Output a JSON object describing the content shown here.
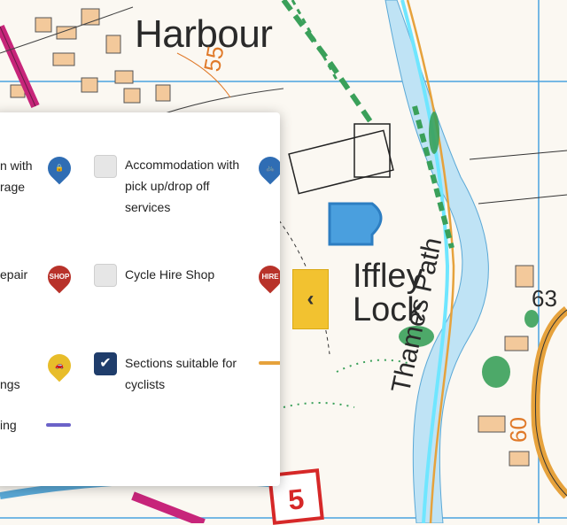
{
  "map": {
    "place_labels": {
      "harbour": "Harbour",
      "iffley_lock": "Iffley Lock",
      "thames_path": "Thames Path",
      "contour_55": "55",
      "contour_60": "60",
      "house_63": "63",
      "road_number": "5"
    },
    "colors": {
      "river": "#bfe3f5",
      "footpath_green": "#3aa05a",
      "cycle_route": "#e6a23c",
      "road_magenta": "#c7257a",
      "building": "#f3c99b"
    }
  },
  "legend": {
    "items": [
      {
        "label": "n with",
        "label2": "rage",
        "icon": "bike-lock-pin-icon",
        "color": "#2f6db4",
        "checked": false
      },
      {
        "label": "Accommodation with pick up/drop off services",
        "icon": "bike-pin-icon",
        "color": "#2f6db4",
        "checked": false
      },
      {
        "label": "epair",
        "icon": "shop-pin-icon",
        "pin_text": "SHOP",
        "color": "#b8322a",
        "checked": false
      },
      {
        "label": "Cycle Hire Shop",
        "icon": "hire-pin-icon",
        "pin_text": "HIRE",
        "color": "#b8322a",
        "checked": false
      },
      {
        "label": "ngs",
        "icon": "car-pin-icon",
        "color": "#e8bd2a",
        "checked": false
      },
      {
        "label": "Sections suitable for cyclists",
        "icon": "orange-line-swatch",
        "color": "#e6a23c",
        "checked": true
      },
      {
        "label": "ing",
        "icon": "purple-line-swatch",
        "color": "#6b62c8",
        "checked": false
      }
    ]
  },
  "toggle": {
    "glyph": "‹"
  }
}
